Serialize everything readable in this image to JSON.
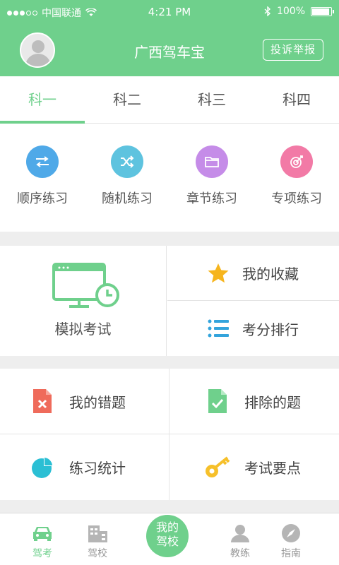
{
  "status_bar": {
    "carrier": "中国联通",
    "time": "4:21 PM",
    "battery": "100%"
  },
  "header": {
    "app_title": "广西驾车宝",
    "complain_label": "投诉举报"
  },
  "tabs": [
    {
      "label": "科一",
      "active": true
    },
    {
      "label": "科二",
      "active": false
    },
    {
      "label": "科三",
      "active": false
    },
    {
      "label": "科四",
      "active": false
    }
  ],
  "practice": [
    {
      "label": "顺序练习",
      "icon": "sequence-icon",
      "color": "#4fa9e8"
    },
    {
      "label": "随机练习",
      "icon": "shuffle-icon",
      "color": "#5ec3df"
    },
    {
      "label": "章节练习",
      "icon": "folder-icon",
      "color": "#c58ce8"
    },
    {
      "label": "专项练习",
      "icon": "target-icon",
      "color": "#f27aa6"
    }
  ],
  "main": {
    "mock_exam": "模拟考试",
    "favorites": "我的收藏",
    "ranking": "考分排行"
  },
  "tools": {
    "wrong": "我的错题",
    "excluded": "排除的题",
    "stats": "练习统计",
    "key_points": "考试要点"
  },
  "bottom_nav": {
    "exam": "驾考",
    "school": "驾校",
    "my_school": "我的\n驾校",
    "coach": "教练",
    "guide": "指南"
  },
  "colors": {
    "brand": "#6fd08c",
    "star": "#f6b51e",
    "list": "#34a4dc",
    "wrong": "#ef6b5b",
    "key": "#f6c02a",
    "pie": "#2bbfd4"
  }
}
